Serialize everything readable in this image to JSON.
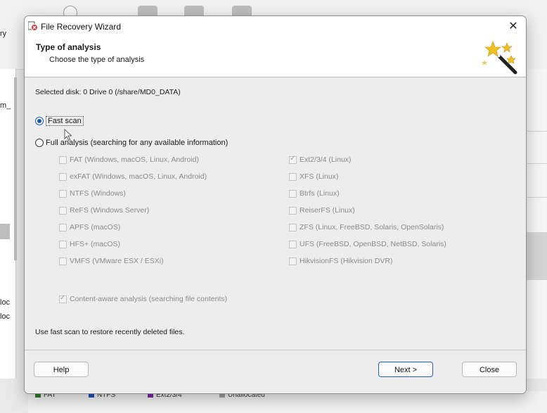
{
  "background": {
    "left_texts": [
      "ry",
      "m_",
      "loc",
      "loc"
    ],
    "legend": [
      {
        "label": "FAT",
        "color": "#2a7a2a"
      },
      {
        "label": "NTFS",
        "color": "#1f4fbf"
      },
      {
        "label": "Ext2/3/4",
        "color": "#7a2aa8"
      },
      {
        "label": "Unallocated",
        "color": "#9a9a9a"
      }
    ]
  },
  "dialog": {
    "title": "File Recovery Wizard",
    "close_icon": "close-icon",
    "header": {
      "title": "Type of analysis",
      "subtitle": "Choose the type of analysis",
      "icon": "magic-wand-icon"
    },
    "selected_disk": "Selected disk: 0 Drive 0 (/share/MD0_DATA)",
    "options": {
      "fast_scan": {
        "label": "Fast scan",
        "checked": true
      },
      "full_analysis": {
        "label": "Full analysis (searching for any available information)",
        "checked": false
      }
    },
    "filesystems_left": [
      {
        "label": "FAT (Windows, macOS, Linux, Android)",
        "checked": false
      },
      {
        "label": "exFAT (Windows, macOS, Linux, Android)",
        "checked": false
      },
      {
        "label": "NTFS (Windows)",
        "checked": false
      },
      {
        "label": "ReFS (Windows Server)",
        "checked": false
      },
      {
        "label": "APFS (macOS)",
        "checked": false
      },
      {
        "label": "HFS+ (macOS)",
        "checked": false
      },
      {
        "label": "VMFS (VMware ESX / ESXi)",
        "checked": false
      }
    ],
    "filesystems_right": [
      {
        "label": "Ext2/3/4 (Linux)",
        "checked": true
      },
      {
        "label": "XFS (Linux)",
        "checked": false
      },
      {
        "label": "Btrfs (Linux)",
        "checked": false
      },
      {
        "label": "ReiserFS (Linux)",
        "checked": false
      },
      {
        "label": "ZFS (Linux, FreeBSD, Solaris, OpenSolaris)",
        "checked": false
      },
      {
        "label": "UFS (FreeBSD, OpenBSD, NetBSD, Solaris)",
        "checked": false
      },
      {
        "label": "HikvisionFS (Hikvision DVR)",
        "checked": false
      }
    ],
    "content_aware": {
      "label": "Content-aware analysis (searching file contents)",
      "checked": true
    },
    "hint": "Use fast scan to restore recently deleted files.",
    "buttons": {
      "help": "Help",
      "next": "Next >",
      "close": "Close"
    }
  }
}
